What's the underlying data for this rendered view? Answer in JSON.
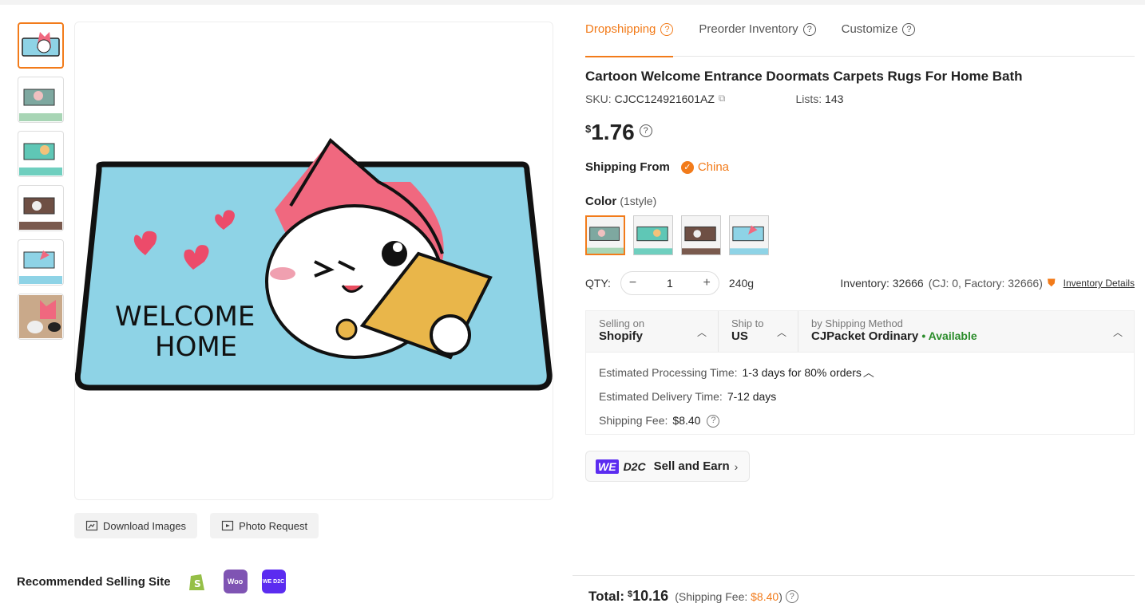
{
  "tabs": [
    {
      "label": "Dropshipping",
      "active": true
    },
    {
      "label": "Preorder Inventory",
      "active": false
    },
    {
      "label": "Customize",
      "active": false
    }
  ],
  "product": {
    "title": "Cartoon Welcome Entrance Doormats Carpets Rugs For Home Bath",
    "sku_label": "SKU:",
    "sku": "CJCC124921601AZ",
    "lists_label": "Lists:",
    "lists": "143",
    "currency": "$",
    "price": "1.76"
  },
  "mat_text": {
    "line1": "WELCOME",
    "line2": "HOME"
  },
  "shipping_from": {
    "label": "Shipping From",
    "value": "China"
  },
  "color": {
    "label": "Color",
    "sub": "(1style)",
    "swatch_count": 4
  },
  "qty": {
    "label": "QTY:",
    "value": "1",
    "weight": "240g",
    "inventory": "Inventory: 32666",
    "inventory_detail": "(CJ: 0, Factory: 32666)",
    "inventory_link": "Inventory Details"
  },
  "shipping": {
    "selling_on_label": "Selling on",
    "selling_on": "Shopify",
    "ship_to_label": "Ship to",
    "ship_to": "US",
    "method_label": "by Shipping Method",
    "method": "CJPacket Ordinary",
    "availability": "• Available",
    "processing_label": "Estimated Processing Time:",
    "processing": "1-3 days for 80% orders",
    "delivery_label": "Estimated Delivery Time:",
    "delivery": "7-12 days",
    "fee_label": "Shipping Fee:",
    "fee": "$8.40"
  },
  "d2c": {
    "we": "WE",
    "d2c": "D2C",
    "label": "Sell and Earn"
  },
  "buttons": {
    "download": "Download Images",
    "photo": "Photo Request"
  },
  "recommended": {
    "label": "Recommended Selling Site",
    "woo": "Woo",
    "we_d2c": "WE D2C"
  },
  "total": {
    "label": "Total:",
    "currency": "$",
    "amount": "10.16",
    "fee_prefix": "(Shipping Fee:",
    "fee": "$8.40",
    "fee_suffix": ")"
  },
  "colors": {
    "accent": "#f27b1a",
    "mat_blue": "#8ed3e6",
    "cat_pink": "#f0687f",
    "available": "#2a8c2a"
  }
}
